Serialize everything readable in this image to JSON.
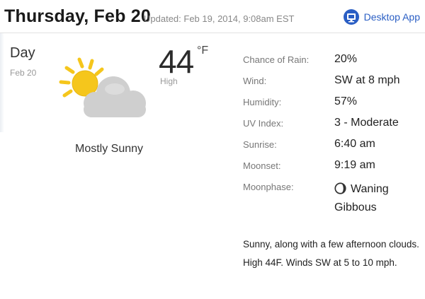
{
  "header": {
    "title": "Thursday, Feb 20",
    "updated": "Updated: Feb 19, 2014, 9:08am EST",
    "desktop_app_label": "Desktop App",
    "desktop_app_icon": "desktop-app-icon"
  },
  "day": {
    "label": "Day",
    "date": "Feb 20",
    "icon": "partly-sunny-icon",
    "temperature": "44",
    "unit": "°F",
    "temperature_label": "High",
    "condition": "Mostly Sunny"
  },
  "details": {
    "rain": {
      "label": "Chance of Rain:",
      "value": "20%"
    },
    "wind": {
      "label": "Wind:",
      "value": "SW at 8 mph"
    },
    "humidity": {
      "label": "Humidity:",
      "value": "57%"
    },
    "uv": {
      "label": "UV Index:",
      "value": "3 - Moderate"
    },
    "sunrise": {
      "label": "Sunrise:",
      "value": "6:40 am"
    },
    "moonset": {
      "label": "Moonset:",
      "value": "9:19 am"
    },
    "moonphase": {
      "label": "Moonphase:",
      "value": "Waning Gibbous",
      "icon": "moon-phase-icon"
    }
  },
  "forecast_text": "Sunny, along with a few afternoon clouds. High 44F. Winds SW at 5 to 10 mph.",
  "colors": {
    "link": "#2a5ec4",
    "sun": "#f5c61c",
    "cloud": "#cfcfcf",
    "muted_text": "#888888"
  }
}
